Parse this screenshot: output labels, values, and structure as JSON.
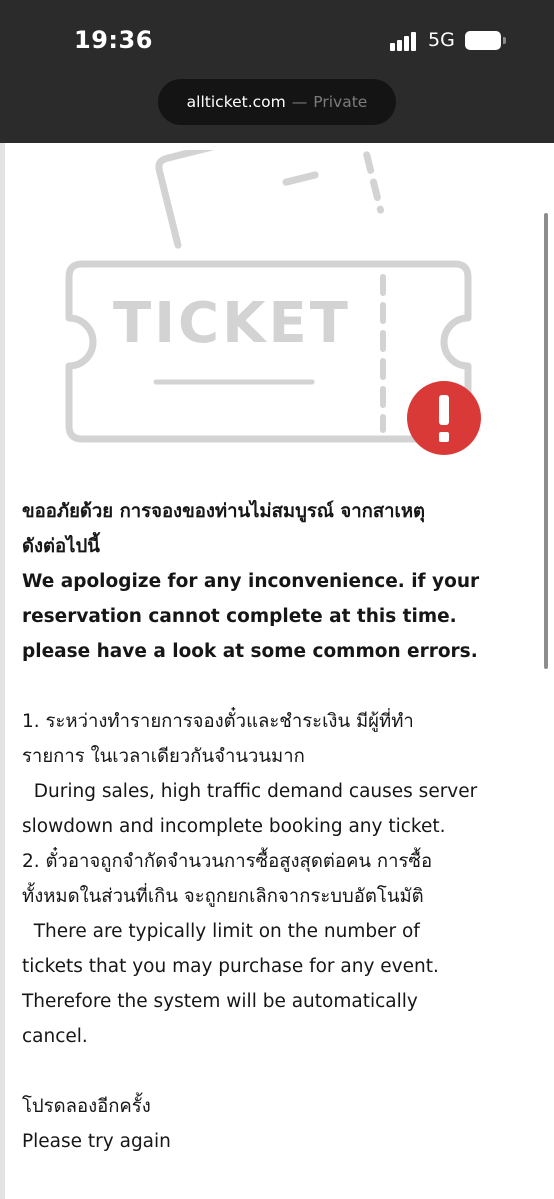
{
  "status_bar": {
    "time": "19:36",
    "network": "5G",
    "icons": [
      "signal-bars-icon",
      "battery-icon"
    ]
  },
  "address_bar": {
    "domain": "allticket.com",
    "separator": "—",
    "mode": "Private"
  },
  "illustration": {
    "ticket_text": "TICKET",
    "badge_icon": "exclamation-icon",
    "badge_color": "#d93a37",
    "line_color": "#d3d3d3"
  },
  "message": {
    "heading_th_1": "ขออภัยด้วย การจองของท่านไม่สมบูรณ์ จากสาเหตุ",
    "heading_th_2": "ดังต่อไปนี้",
    "heading_en_1": "We apologize for any inconvenience. if your",
    "heading_en_2": "reservation cannot complete at this time.",
    "heading_en_3": "please have a look at some common errors.",
    "errors": [
      {
        "th_1": "1. ระหว่างทำรายการจองตั๋วและชำระเงิน มีผู้ที่ทำ",
        "th_2": "รายการ ในเวลาเดียวกันจำนวนมาก",
        "en_1": "  During sales, high traffic demand causes server",
        "en_2": "slowdown and incomplete booking any ticket."
      },
      {
        "th_1": "2. ตั๋วอาจถูกจำกัดจำนวนการซื้อสูงสุดต่อคน การซื้อ",
        "th_2": "ทั้งหมดในส่วนที่เกิน จะถูกยกเลิกจากระบบอัตโนมัติ",
        "en_1": "  There are typically limit on the number of",
        "en_2": "tickets that you may purchase for any event.",
        "en_3": "Therefore the system will be automatically",
        "en_4": "cancel."
      }
    ],
    "retry_th": "โปรดลองอีกครั้ง",
    "retry_en": "Please try again"
  }
}
